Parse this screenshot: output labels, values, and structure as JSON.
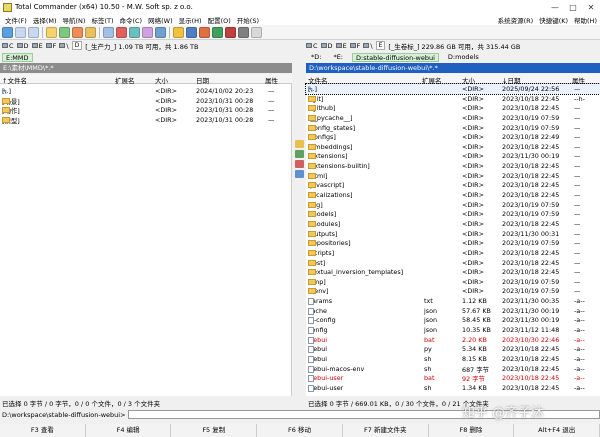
{
  "window": {
    "title": "Total Commander (x64) 10.50 - M.W. Soft sp. z o.o."
  },
  "menu": {
    "items": [
      "文件(F)",
      "选择(M)",
      "导航(N)",
      "标签(T)",
      "命令(C)",
      "网络(W)",
      "显示(H)",
      "配置(O)",
      "开始(S)"
    ],
    "right": [
      "系统资源(R)",
      "快捷键(K)",
      "帮助(H)"
    ]
  },
  "left": {
    "drivebar": {
      "drive": "D",
      "free": "[_生产力_] 1.09 TB 可用，共 1.86 TB"
    },
    "tab": "E:MMD",
    "path": "E:\\素材\\MMD\\*.*",
    "headers": {
      "name": "↑文件名",
      "ext": "扩展名",
      "size": "大小",
      "date": "日期",
      "attr": "属性"
    },
    "rows": [
      {
        "name": "[..]",
        "size": "<DIR>",
        "date": "2024/10/02 20:23",
        "attr": "—"
      },
      {
        "name": "[场景]",
        "size": "<DIR>",
        "date": "2023/10/31 00:28",
        "attr": "—"
      },
      {
        "name": "[动作]",
        "size": "<DIR>",
        "date": "2023/10/31 00:28",
        "attr": "—"
      },
      {
        "name": "[模型]",
        "size": "<DIR>",
        "date": "2023/10/31 00:28",
        "attr": "—"
      }
    ],
    "status": "已选择 0 字节 / 0 字节，0 / 0 个文件，0 / 3 个文件夹"
  },
  "right": {
    "drivebar": {
      "drive": "E",
      "free": "[_生卷标_] 229.86 GB 可用，共 315.44 GB"
    },
    "tabs": [
      "D:stable-diffusion-webui",
      "D:models"
    ],
    "path": "D:\\workspace\\stable-diffusion-webui\\*.*",
    "headers": {
      "name": "文件名",
      "ext": "扩展名",
      "size": "大小",
      "date": "↓日期",
      "attr": "属性"
    },
    "rows": [
      {
        "name": "[..]",
        "ext": "",
        "size": "<DIR>",
        "date": "2025/09/24 22:56",
        "attr": "—",
        "kind": "up"
      },
      {
        "name": "[.git]",
        "ext": "",
        "size": "<DIR>",
        "date": "2023/10/18 22:45",
        "attr": "--h-",
        "kind": "dir"
      },
      {
        "name": "[.github]",
        "ext": "",
        "size": "<DIR>",
        "date": "2023/10/18 22:45",
        "attr": "—",
        "kind": "dir"
      },
      {
        "name": "[__pycache__]",
        "ext": "",
        "size": "<DIR>",
        "date": "2023/10/19 07:59",
        "attr": "—",
        "kind": "dir"
      },
      {
        "name": "[config_states]",
        "ext": "",
        "size": "<DIR>",
        "date": "2023/10/19 07:59",
        "attr": "—",
        "kind": "dir"
      },
      {
        "name": "[configs]",
        "ext": "",
        "size": "<DIR>",
        "date": "2023/10/18 22:49",
        "attr": "—",
        "kind": "dir"
      },
      {
        "name": "[embeddings]",
        "ext": "",
        "size": "<DIR>",
        "date": "2023/10/18 22:45",
        "attr": "—",
        "kind": "dir"
      },
      {
        "name": "[extensions]",
        "ext": "",
        "size": "<DIR>",
        "date": "2023/11/30 00:19",
        "attr": "—",
        "kind": "dir"
      },
      {
        "name": "[extensions-builtin]",
        "ext": "",
        "size": "<DIR>",
        "date": "2023/10/18 22:45",
        "attr": "—",
        "kind": "dir"
      },
      {
        "name": "[html]",
        "ext": "",
        "size": "<DIR>",
        "date": "2023/10/18 22:45",
        "attr": "—",
        "kind": "dir"
      },
      {
        "name": "[javascript]",
        "ext": "",
        "size": "<DIR>",
        "date": "2023/10/18 22:45",
        "attr": "—",
        "kind": "dir"
      },
      {
        "name": "[localizations]",
        "ext": "",
        "size": "<DIR>",
        "date": "2023/10/18 22:45",
        "attr": "—",
        "kind": "dir"
      },
      {
        "name": "[log]",
        "ext": "",
        "size": "<DIR>",
        "date": "2023/10/19 07:59",
        "attr": "—",
        "kind": "dir"
      },
      {
        "name": "[models]",
        "ext": "",
        "size": "<DIR>",
        "date": "2023/10/19 07:59",
        "attr": "—",
        "kind": "dir"
      },
      {
        "name": "[modules]",
        "ext": "",
        "size": "<DIR>",
        "date": "2023/10/18 22:45",
        "attr": "—",
        "kind": "dir"
      },
      {
        "name": "[outputs]",
        "ext": "",
        "size": "<DIR>",
        "date": "2023/11/30 00:31",
        "attr": "—",
        "kind": "dir"
      },
      {
        "name": "[repositories]",
        "ext": "",
        "size": "<DIR>",
        "date": "2023/10/19 07:59",
        "attr": "—",
        "kind": "dir"
      },
      {
        "name": "[scripts]",
        "ext": "",
        "size": "<DIR>",
        "date": "2023/10/18 22:45",
        "attr": "—",
        "kind": "dir"
      },
      {
        "name": "[test]",
        "ext": "",
        "size": "<DIR>",
        "date": "2023/10/18 22:45",
        "attr": "—",
        "kind": "dir"
      },
      {
        "name": "[textual_inversion_templates]",
        "ext": "",
        "size": "<DIR>",
        "date": "2023/10/18 22:45",
        "attr": "—",
        "kind": "dir"
      },
      {
        "name": "[tmp]",
        "ext": "",
        "size": "<DIR>",
        "date": "2023/10/19 07:59",
        "attr": "—",
        "kind": "dir"
      },
      {
        "name": "[venv]",
        "ext": "",
        "size": "<DIR>",
        "date": "2023/10/19 07:59",
        "attr": "—",
        "kind": "dir"
      },
      {
        "name": "params",
        "ext": "txt",
        "size": "1.12 KB",
        "date": "2023/11/30 00:35",
        "attr": "-a--",
        "kind": "file"
      },
      {
        "name": "cache",
        "ext": "json",
        "size": "57.67 KB",
        "date": "2023/11/30 00:19",
        "attr": "-a--",
        "kind": "file"
      },
      {
        "name": "ui-config",
        "ext": "json",
        "size": "58.45 KB",
        "date": "2023/11/30 00:19",
        "attr": "-a--",
        "kind": "file"
      },
      {
        "name": "config",
        "ext": "json",
        "size": "10.35 KB",
        "date": "2023/11/12 11:48",
        "attr": "-a--",
        "kind": "file"
      },
      {
        "name": "webui",
        "ext": "bat",
        "size": "2.20 KB",
        "date": "2023/10/30 22:46",
        "attr": "-a--",
        "kind": "file",
        "red": true
      },
      {
        "name": "webui",
        "ext": "py",
        "size": "5.34 KB",
        "date": "2023/10/18 22:45",
        "attr": "-a--",
        "kind": "file"
      },
      {
        "name": "webui",
        "ext": "sh",
        "size": "8.15 KB",
        "date": "2023/10/18 22:45",
        "attr": "-a--",
        "kind": "file"
      },
      {
        "name": "webui-macos-env",
        "ext": "sh",
        "size": "687 字节",
        "date": "2023/10/18 22:45",
        "attr": "-a--",
        "kind": "file"
      },
      {
        "name": "webui-user",
        "ext": "bat",
        "size": "92 字节",
        "date": "2023/10/18 22:45",
        "attr": "-a--",
        "kind": "file",
        "red": true
      },
      {
        "name": "webui-user",
        "ext": "sh",
        "size": "1.34 KB",
        "date": "2023/10/18 22:45",
        "attr": "-a--",
        "kind": "file"
      }
    ],
    "status": "已选择 0 字节 / 669.01 KB，0 / 30 个文件，0 / 21 个文件夹"
  },
  "cmdline": {
    "prompt": "D:\\workspace\\stable-diffusion-webui>"
  },
  "fkeys": [
    "F3 查看",
    "F4 编辑",
    "F5 复制",
    "F6 移动",
    "F7 新建文件夹",
    "F8 删除",
    "Alt+F4 退出"
  ],
  "watermark": "知乎 @齐子沐",
  "colors": {
    "path_active": "#1f5fbf",
    "path_inactive": "#8c8c8c",
    "row_red": "#cc0000",
    "tab_active": "#d8f0d8"
  }
}
